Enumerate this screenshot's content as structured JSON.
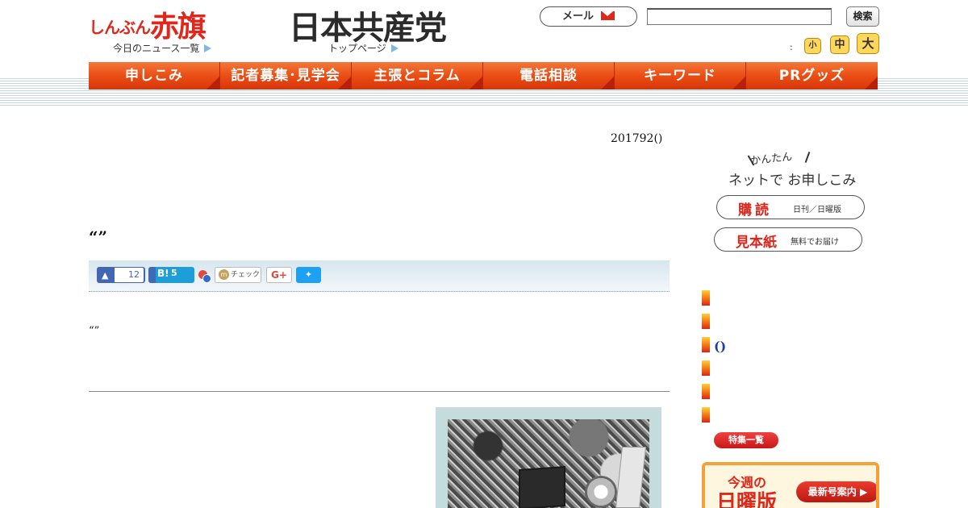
{
  "header": {
    "logo_akahata_small": "しんぶん",
    "logo_akahata_big": "赤旗",
    "logo_jcp": "日本共産党",
    "news_list_link": "今日のニュース一覧",
    "top_page_link": "トップページ",
    "mail_label": "メール",
    "search_value": "",
    "search_button": "検索",
    "font_size_colon": ":",
    "font_small": "小",
    "font_mid": "中",
    "font_large": "大"
  },
  "nav": {
    "items": [
      "申しこみ",
      "記者募集･見学会",
      "主張とコラム",
      "電話相談",
      "キーワード",
      "PRグッズ"
    ]
  },
  "article": {
    "date": "201792()",
    "headline": "“”",
    "subhead": "“”"
  },
  "share": {
    "like_count": "12",
    "hatena_label": "B!",
    "hatena_count": "5",
    "mixi_label": "チェック",
    "gplus_label": "G+"
  },
  "sidebar": {
    "kantan": "かんたん",
    "net_apply": "ネットで お申しこみ",
    "subscribe_title": "購読",
    "subscribe_sub": "日刊／日曜版",
    "sample_title": "見本紙",
    "sample_sub": "無料でお届け",
    "paren": "()",
    "feature_list": "特集一覧",
    "sunday_week": "今週の",
    "sunday_name": "日曜版",
    "latest_issue": "最新号案内 ▶"
  },
  "colors": {
    "brand_red": "#e0271c",
    "nav_orange": "#ea4e14",
    "link_blue": "#1a3d9e"
  }
}
